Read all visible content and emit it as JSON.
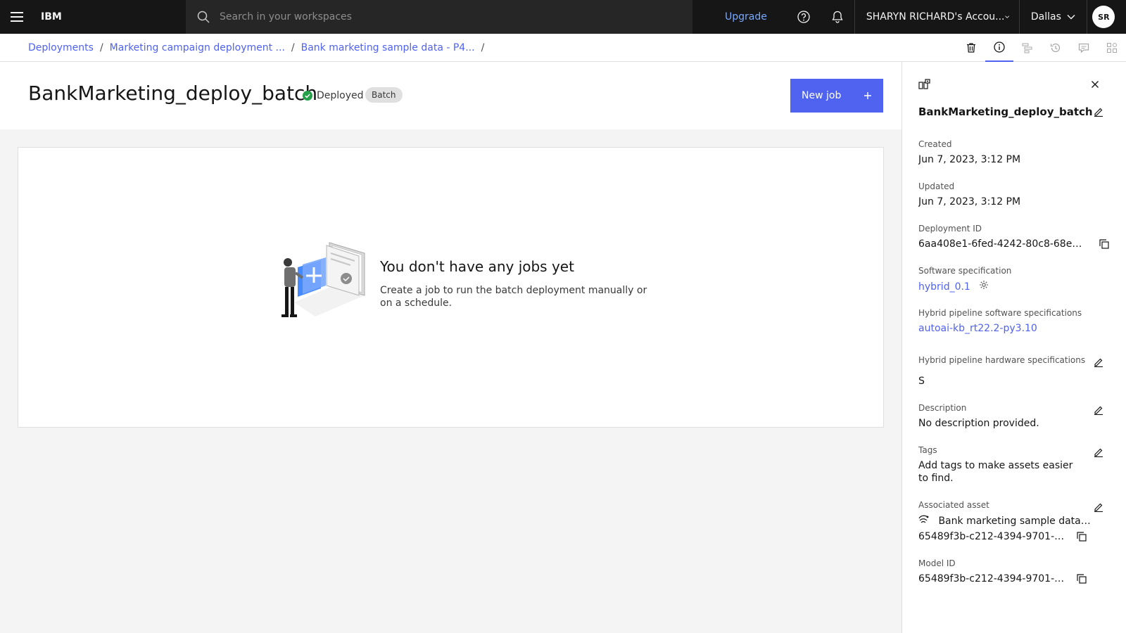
{
  "header": {
    "brand": "IBM",
    "search_placeholder": "Search in your workspaces",
    "upgrade": "Upgrade",
    "account": "SHARYN RICHARD's Accou...",
    "region": "Dallas",
    "avatar_initials": "SR"
  },
  "breadcrumb": [
    "Deployments",
    "Marketing campaign deployment ...",
    "Bank marketing sample data - P4..."
  ],
  "breadcrumb_sep": "/",
  "page": {
    "title": "BankMarketing_deploy_batch",
    "status": "Deployed",
    "type_tag": "Batch",
    "new_job_label": "New job"
  },
  "empty_state": {
    "title": "You don't have any jobs yet",
    "description": "Create a job to run the batch deployment manually or on a schedule."
  },
  "panel": {
    "name": "BankMarketing_deploy_batch",
    "fields": {
      "created_label": "Created",
      "created": "Jun 7, 2023, 3:12 PM",
      "updated_label": "Updated",
      "updated": "Jun 7, 2023, 3:12 PM",
      "deployment_id_label": "Deployment ID",
      "deployment_id": "6aa408e1-6fed-4242-80c8-68e35...",
      "software_spec_label": "Software specification",
      "software_spec": "hybrid_0.1",
      "hybrid_sw_label": "Hybrid pipeline software specifications",
      "hybrid_sw": "autoai-kb_rt22.2-py3.10",
      "hybrid_hw_label": "Hybrid pipeline hardware specifications",
      "hybrid_hw": "S",
      "description_label": "Description",
      "description": "No description provided.",
      "tags_label": "Tags",
      "tags": "Add tags to make assets easier to find.",
      "asset_label": "Associated asset",
      "asset_name": "Bank marketing sample data - P4",
      "asset_id": "65489f3b-c212-4394-9701-1...",
      "model_id_label": "Model ID",
      "model_id": "65489f3b-c212-4394-9701-1..."
    }
  },
  "colors": {
    "accent": "#4f62f0",
    "header_bg": "#161616",
    "deployed_green": "#24a148"
  }
}
